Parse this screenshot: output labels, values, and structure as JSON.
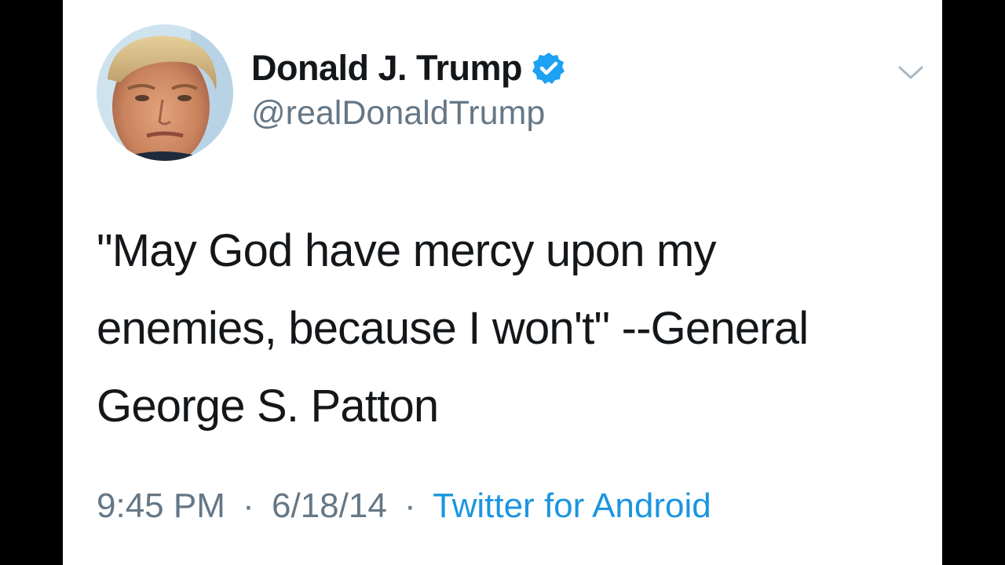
{
  "colors": {
    "background": "#000000",
    "card": "#ffffff",
    "text_primary": "#14171a",
    "text_secondary": "#657786",
    "accent_link": "#1b95e0",
    "verified_badge": "#1da1f2"
  },
  "author": {
    "display_name": "Donald J. Trump",
    "handle": "@realDonaldTrump",
    "verified": true,
    "avatar_icon": "profile-photo"
  },
  "tweet": {
    "text_lines": [
      "\"May God have mercy upon my",
      "enemies, because I won't\" --General",
      "George S. Patton"
    ]
  },
  "meta": {
    "time": "9:45 PM",
    "date": "6/18/14",
    "separator": "·",
    "source": "Twitter for Android"
  },
  "icons": {
    "menu": "chevron-down-icon",
    "verified": "verified-badge-icon"
  }
}
